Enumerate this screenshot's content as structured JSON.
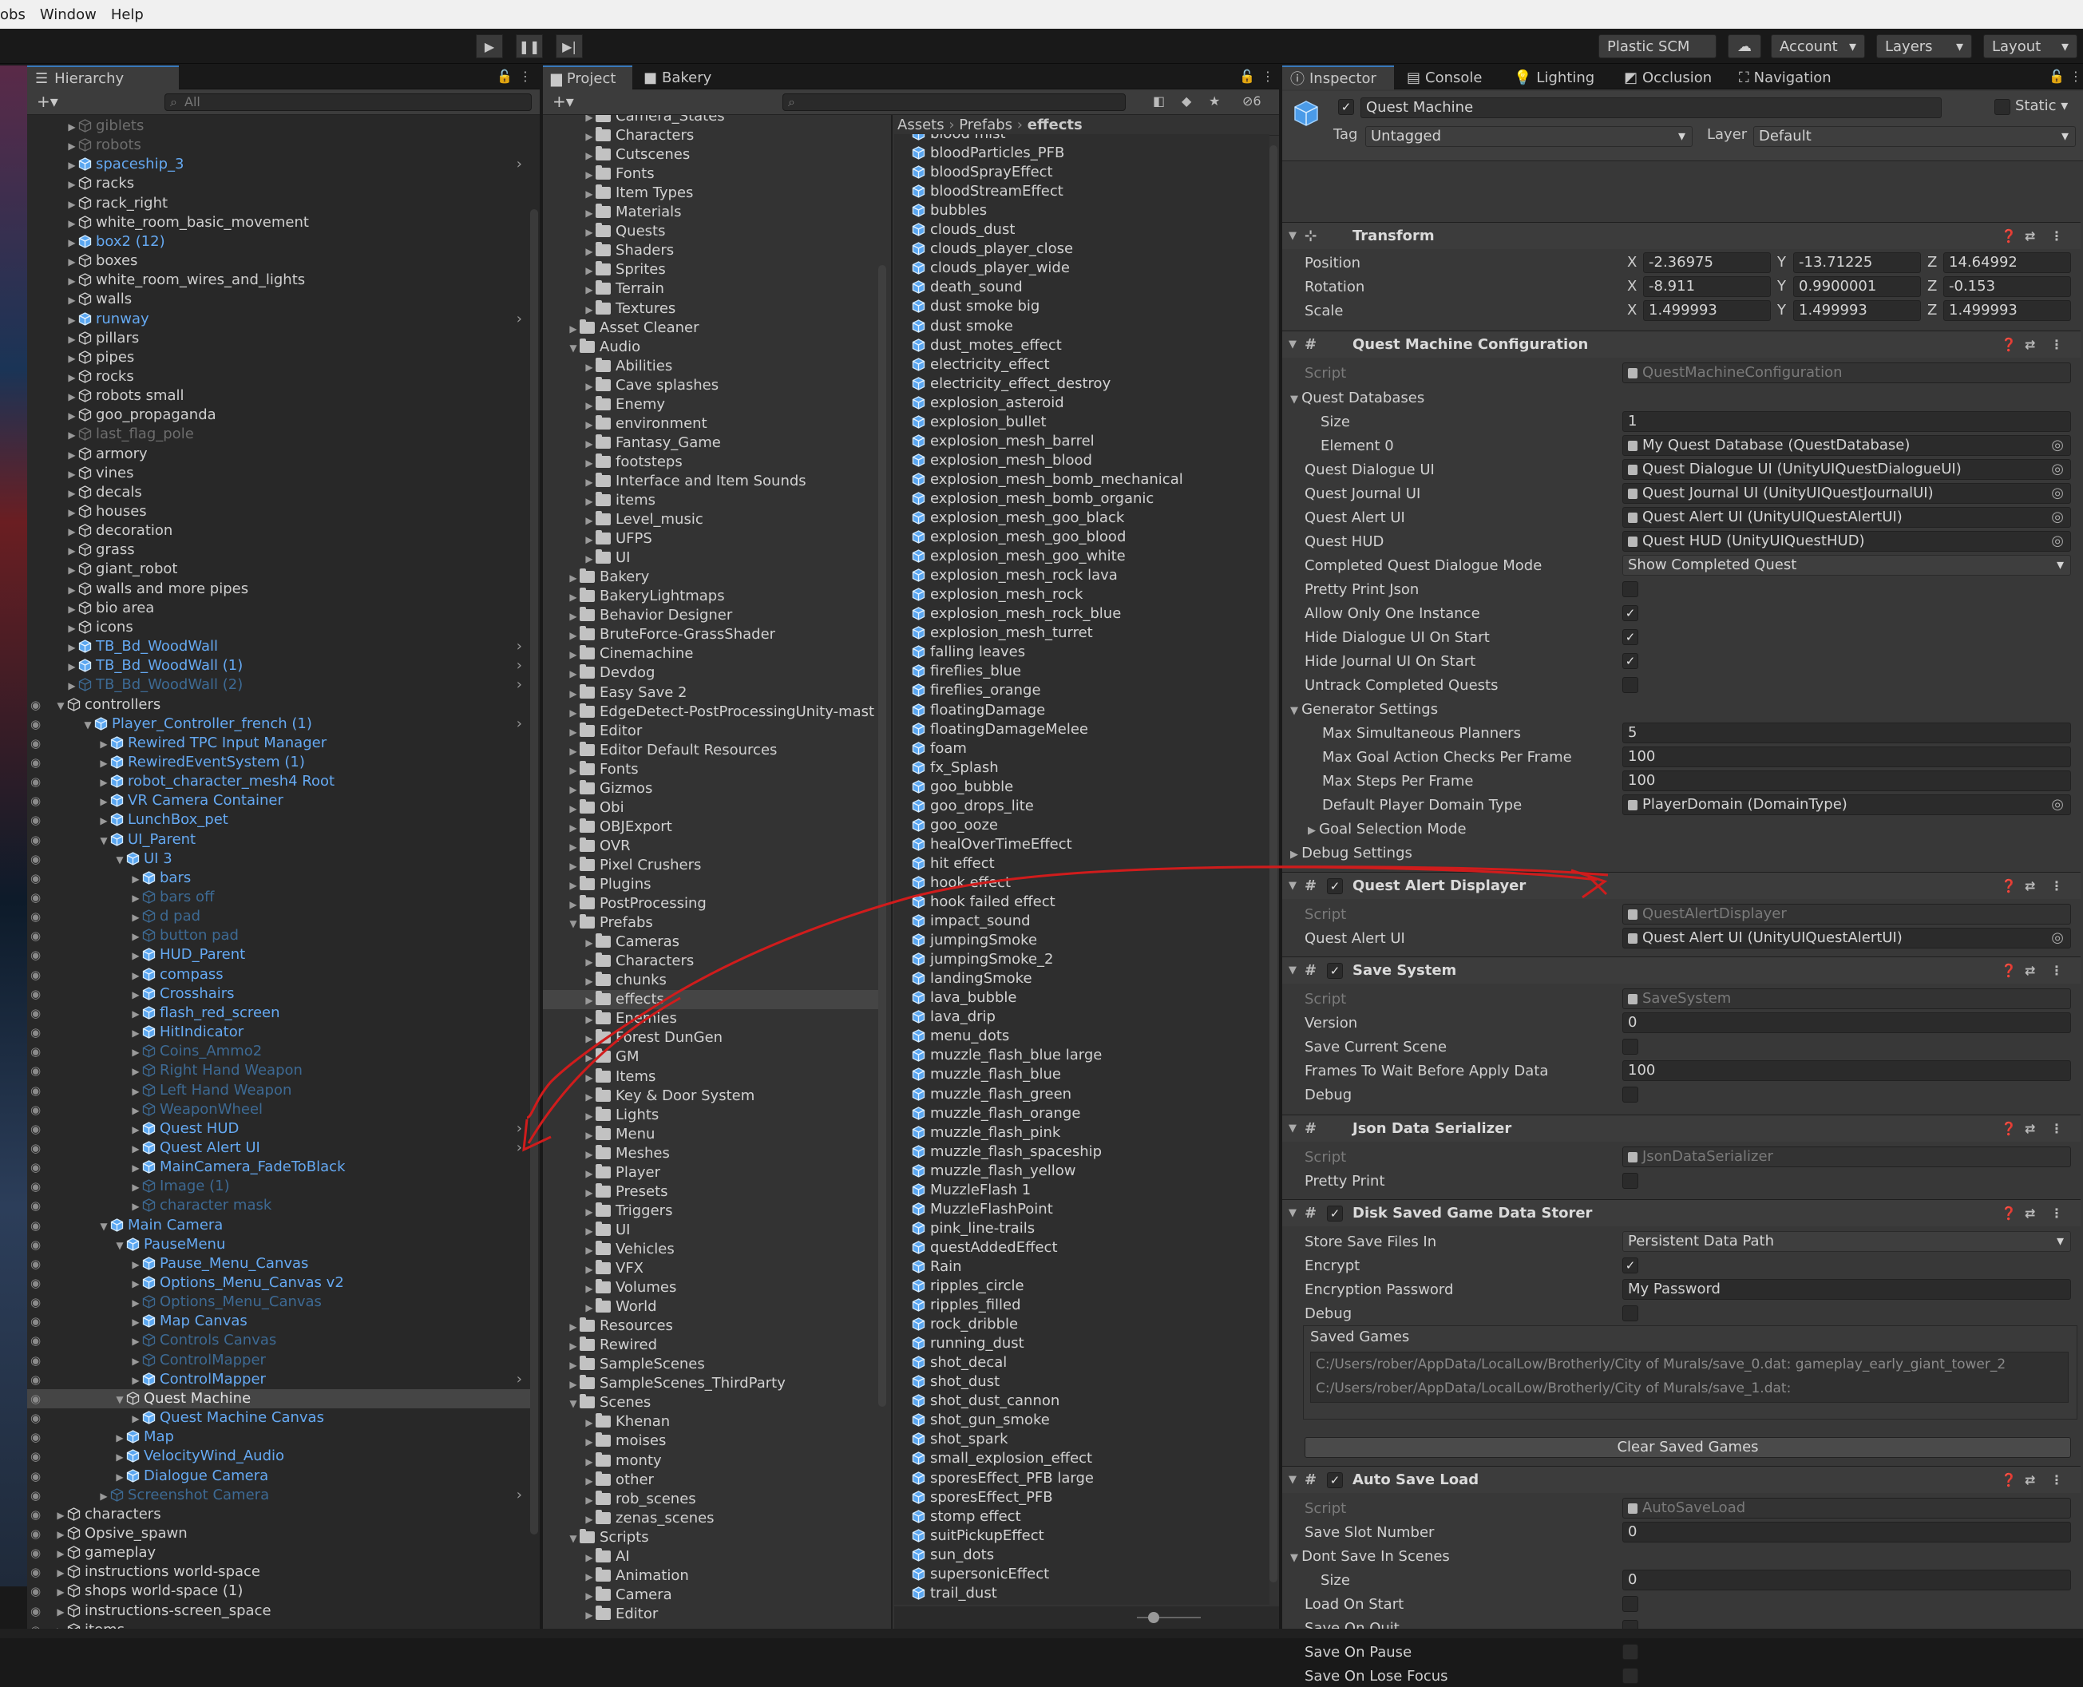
{
  "menu": [
    "obs",
    "Window",
    "Help"
  ],
  "toolbar": {
    "plastic": "Plastic SCM",
    "account": "Account",
    "layers": "Layers",
    "layout": "Layout"
  },
  "hierarchy": {
    "tab": "Hierarchy",
    "search_placeholder": "All",
    "rows": [
      {
        "t": "giblets",
        "i": 0,
        "s": "dim"
      },
      {
        "t": "robots",
        "i": 0,
        "s": "dim"
      },
      {
        "t": "spaceship_3",
        "i": 0,
        "s": "blue"
      },
      {
        "t": "racks",
        "i": 0,
        "s": ""
      },
      {
        "t": "rack_right",
        "i": 0,
        "s": ""
      },
      {
        "t": "white_room_basic_movement",
        "i": 0,
        "s": ""
      },
      {
        "t": "box2 (12)",
        "i": 0,
        "s": "blue"
      },
      {
        "t": "boxes",
        "i": 0,
        "s": ""
      },
      {
        "t": "white_room_wires_and_lights",
        "i": 0,
        "s": ""
      },
      {
        "t": "walls",
        "i": 0,
        "s": ""
      },
      {
        "t": "runway",
        "i": 0,
        "s": "blue"
      },
      {
        "t": "pillars",
        "i": 0,
        "s": ""
      },
      {
        "t": "pipes",
        "i": 0,
        "s": ""
      },
      {
        "t": "rocks",
        "i": 0,
        "s": ""
      },
      {
        "t": "robots small",
        "i": 0,
        "s": ""
      },
      {
        "t": "goo_propaganda",
        "i": 0,
        "s": ""
      },
      {
        "t": "last_flag_pole",
        "i": 0,
        "s": "dim"
      },
      {
        "t": "armory",
        "i": 0,
        "s": ""
      },
      {
        "t": "vines",
        "i": 0,
        "s": ""
      },
      {
        "t": "decals",
        "i": 0,
        "s": ""
      },
      {
        "t": "houses",
        "i": 0,
        "s": ""
      },
      {
        "t": "decoration",
        "i": 0,
        "s": ""
      },
      {
        "t": "grass",
        "i": 0,
        "s": ""
      },
      {
        "t": "giant_robot",
        "i": 0,
        "s": ""
      },
      {
        "t": "walls and more pipes",
        "i": 0,
        "s": ""
      },
      {
        "t": "bio area",
        "i": 0,
        "s": ""
      },
      {
        "t": "icons",
        "i": 0,
        "s": ""
      },
      {
        "t": "TB_Bd_WoodWall",
        "i": 0,
        "s": "blue"
      },
      {
        "t": "TB_Bd_WoodWall (1)",
        "i": 0,
        "s": "blue"
      },
      {
        "t": "TB_Bd_WoodWall (2)",
        "i": 0,
        "s": "dimblue"
      },
      {
        "t": "controllers",
        "i": -1,
        "s": ""
      },
      {
        "t": "Player_Controller_french (1)",
        "i": 0,
        "s": "blue"
      },
      {
        "t": "Rewired TPC Input Manager",
        "i": 1,
        "s": "blue"
      },
      {
        "t": "RewiredEventSystem (1)",
        "i": 1,
        "s": "blue"
      },
      {
        "t": "robot_character_mesh4 Root",
        "i": 1,
        "s": "blue"
      },
      {
        "t": "VR Camera Container",
        "i": 1,
        "s": "blue"
      },
      {
        "t": "LunchBox_pet",
        "i": 1,
        "s": "blue"
      },
      {
        "t": "UI_Parent",
        "i": 1,
        "s": "blue"
      },
      {
        "t": "UI 3",
        "i": 2,
        "s": "blue"
      },
      {
        "t": "bars",
        "i": 3,
        "s": "blue"
      },
      {
        "t": "bars off",
        "i": 3,
        "s": "dimblue"
      },
      {
        "t": "d pad",
        "i": 3,
        "s": "dimblue"
      },
      {
        "t": "button pad",
        "i": 3,
        "s": "dimblue"
      },
      {
        "t": "HUD_Parent",
        "i": 3,
        "s": "blue"
      },
      {
        "t": "compass",
        "i": 3,
        "s": "blue"
      },
      {
        "t": "Crosshairs",
        "i": 3,
        "s": "blue"
      },
      {
        "t": "flash_red_screen",
        "i": 3,
        "s": "blue"
      },
      {
        "t": "HitIndicator",
        "i": 3,
        "s": "blue"
      },
      {
        "t": "Coins_Ammo2",
        "i": 3,
        "s": "dimblue"
      },
      {
        "t": "Right Hand Weapon",
        "i": 3,
        "s": "dimblue"
      },
      {
        "t": "Left Hand Weapon",
        "i": 3,
        "s": "dimblue"
      },
      {
        "t": "WeaponWheel",
        "i": 3,
        "s": "dimblue"
      },
      {
        "t": "Quest HUD",
        "i": 3,
        "s": "blue"
      },
      {
        "t": "Quest Alert UI",
        "i": 3,
        "s": "blue"
      },
      {
        "t": "MainCamera_FadeToBlack",
        "i": 3,
        "s": "blue"
      },
      {
        "t": "Image (1)",
        "i": 3,
        "s": "dimblue"
      },
      {
        "t": "character mask",
        "i": 3,
        "s": "dimblue"
      },
      {
        "t": "Main Camera",
        "i": 1,
        "s": "blue"
      },
      {
        "t": "PauseMenu",
        "i": 2,
        "s": "blue"
      },
      {
        "t": "Pause_Menu_Canvas",
        "i": 3,
        "s": "blue"
      },
      {
        "t": "Options_Menu_Canvas v2",
        "i": 3,
        "s": "blue"
      },
      {
        "t": "Options_Menu_Canvas",
        "i": 3,
        "s": "dimblue"
      },
      {
        "t": "Map Canvas",
        "i": 3,
        "s": "blue"
      },
      {
        "t": "Controls Canvas",
        "i": 3,
        "s": "dimblue"
      },
      {
        "t": "ControlMapper",
        "i": 3,
        "s": "dimblue"
      },
      {
        "t": "ControlMapper",
        "i": 3,
        "s": "blue"
      },
      {
        "t": "Quest Machine",
        "i": 2,
        "s": "sel"
      },
      {
        "t": "Quest Machine Canvas",
        "i": 3,
        "s": "blue"
      },
      {
        "t": "Map",
        "i": 2,
        "s": "blue"
      },
      {
        "t": "VelocityWind_Audio",
        "i": 2,
        "s": "blue"
      },
      {
        "t": "Dialogue Camera",
        "i": 2,
        "s": "blue"
      },
      {
        "t": "Screenshot Camera",
        "i": 1,
        "s": "dimblue"
      },
      {
        "t": "characters",
        "i": -1,
        "s": ""
      },
      {
        "t": "Opsive_spawn",
        "i": -1,
        "s": ""
      },
      {
        "t": "gameplay",
        "i": -1,
        "s": ""
      },
      {
        "t": "instructions world-space",
        "i": -1,
        "s": ""
      },
      {
        "t": "shops world-space (1)",
        "i": -1,
        "s": ""
      },
      {
        "t": "instructions-screen_space",
        "i": -1,
        "s": ""
      },
      {
        "t": "items",
        "i": -1,
        "s": ""
      }
    ]
  },
  "project": {
    "tabs": [
      "Project",
      "Bakery"
    ],
    "breadcrumb": [
      "Assets",
      "Prefabs",
      "effects"
    ],
    "badge": "6",
    "folders": [
      {
        "t": "Camera_States",
        "i": 2
      },
      {
        "t": "Characters",
        "i": 2
      },
      {
        "t": "Cutscenes",
        "i": 2
      },
      {
        "t": "Fonts",
        "i": 2
      },
      {
        "t": "Item Types",
        "i": 2
      },
      {
        "t": "Materials",
        "i": 2
      },
      {
        "t": "Quests",
        "i": 2
      },
      {
        "t": "Shaders",
        "i": 2
      },
      {
        "t": "Sprites",
        "i": 2
      },
      {
        "t": "Terrain",
        "i": 2
      },
      {
        "t": "Textures",
        "i": 2
      },
      {
        "t": "Asset Cleaner",
        "i": 1
      },
      {
        "t": "Audio",
        "i": 1
      },
      {
        "t": "Abilities",
        "i": 2
      },
      {
        "t": "Cave splashes",
        "i": 2
      },
      {
        "t": "Enemy",
        "i": 2
      },
      {
        "t": "environment",
        "i": 2
      },
      {
        "t": "Fantasy_Game",
        "i": 2
      },
      {
        "t": "footsteps",
        "i": 2
      },
      {
        "t": "Interface and Item Sounds",
        "i": 2
      },
      {
        "t": "items",
        "i": 2
      },
      {
        "t": "Level_music",
        "i": 2
      },
      {
        "t": "UFPS",
        "i": 2
      },
      {
        "t": "UI",
        "i": 2
      },
      {
        "t": "Bakery",
        "i": 1
      },
      {
        "t": "BakeryLightmaps",
        "i": 1
      },
      {
        "t": "Behavior Designer",
        "i": 1
      },
      {
        "t": "BruteForce-GrassShader",
        "i": 1
      },
      {
        "t": "Cinemachine",
        "i": 1
      },
      {
        "t": "Devdog",
        "i": 1
      },
      {
        "t": "Easy Save 2",
        "i": 1
      },
      {
        "t": "EdgeDetect-PostProcessingUnity-mast",
        "i": 1
      },
      {
        "t": "Editor",
        "i": 1
      },
      {
        "t": "Editor Default Resources",
        "i": 1
      },
      {
        "t": "Fonts",
        "i": 1
      },
      {
        "t": "Gizmos",
        "i": 1
      },
      {
        "t": "Obi",
        "i": 1
      },
      {
        "t": "OBJExport",
        "i": 1
      },
      {
        "t": "OVR",
        "i": 1
      },
      {
        "t": "Pixel Crushers",
        "i": 1
      },
      {
        "t": "Plugins",
        "i": 1
      },
      {
        "t": "PostProcessing",
        "i": 1
      },
      {
        "t": "Prefabs",
        "i": 1
      },
      {
        "t": "Cameras",
        "i": 2
      },
      {
        "t": "Characters",
        "i": 2
      },
      {
        "t": "chunks",
        "i": 2
      },
      {
        "t": "effects",
        "i": 2
      },
      {
        "t": "Enemies",
        "i": 2
      },
      {
        "t": "Forest DunGen",
        "i": 2
      },
      {
        "t": "GM",
        "i": 2
      },
      {
        "t": "Items",
        "i": 2
      },
      {
        "t": "Key & Door System",
        "i": 2
      },
      {
        "t": "Lights",
        "i": 2
      },
      {
        "t": "Menu",
        "i": 2
      },
      {
        "t": "Meshes",
        "i": 2
      },
      {
        "t": "Player",
        "i": 2
      },
      {
        "t": "Presets",
        "i": 2
      },
      {
        "t": "Triggers",
        "i": 2
      },
      {
        "t": "UI",
        "i": 2
      },
      {
        "t": "Vehicles",
        "i": 2
      },
      {
        "t": "VFX",
        "i": 2
      },
      {
        "t": "Volumes",
        "i": 2
      },
      {
        "t": "World",
        "i": 2
      },
      {
        "t": "Resources",
        "i": 1
      },
      {
        "t": "Rewired",
        "i": 1
      },
      {
        "t": "SampleScenes",
        "i": 1
      },
      {
        "t": "SampleScenes_ThirdParty",
        "i": 1
      },
      {
        "t": "Scenes",
        "i": 1
      },
      {
        "t": "Khenan",
        "i": 2
      },
      {
        "t": "moises",
        "i": 2
      },
      {
        "t": "monty",
        "i": 2
      },
      {
        "t": "other",
        "i": 2
      },
      {
        "t": "rob_scenes",
        "i": 2
      },
      {
        "t": "zenas_scenes",
        "i": 2
      },
      {
        "t": "Scripts",
        "i": 1
      },
      {
        "t": "AI",
        "i": 2
      },
      {
        "t": "Animation",
        "i": 2
      },
      {
        "t": "Camera",
        "i": 2
      },
      {
        "t": "Editor",
        "i": 2
      }
    ],
    "assets": [
      "blood mist",
      "bloodParticles_PFB",
      "bloodSprayEffect",
      "bloodStreamEffect",
      "bubbles",
      "clouds_dust",
      "clouds_player_close",
      "clouds_player_wide",
      "death_sound",
      "dust smoke big",
      "dust smoke",
      "dust_motes_effect",
      "electricity_effect",
      "electricity_effect_destroy",
      "explosion_asteroid",
      "explosion_bullet",
      "explosion_mesh_barrel",
      "explosion_mesh_blood",
      "explosion_mesh_bomb_mechanical",
      "explosion_mesh_bomb_organic",
      "explosion_mesh_goo_black",
      "explosion_mesh_goo_blood",
      "explosion_mesh_goo_white",
      "explosion_mesh_rock lava",
      "explosion_mesh_rock",
      "explosion_mesh_rock_blue",
      "explosion_mesh_turret",
      "falling leaves",
      "fireflies_blue",
      "fireflies_orange",
      "floatingDamage",
      "floatingDamageMelee",
      "foam",
      "fx_Splash",
      "goo_bubble",
      "goo_drops_lite",
      "goo_ooze",
      "healOverTimeEffect",
      "hit effect",
      "hook effect",
      "hook failed effect",
      "impact_sound",
      "jumpingSmoke",
      "jumpingSmoke_2",
      "landingSmoke",
      "lava_bubble",
      "lava_drip",
      "menu_dots",
      "muzzle_flash_blue large",
      "muzzle_flash_blue",
      "muzzle_flash_green",
      "muzzle_flash_orange",
      "muzzle_flash_pink",
      "muzzle_flash_spaceship",
      "muzzle_flash_yellow",
      "MuzzleFlash 1",
      "MuzzleFlashPoint",
      "pink_line-trails",
      "questAddedEffect",
      "Rain",
      "ripples_circle",
      "ripples_filled",
      "rock_dribble",
      "running_dust",
      "shot_decal",
      "shot_dust",
      "shot_dust_cannon",
      "shot_gun_smoke",
      "shot_spark",
      "small_explosion_effect",
      "sporesEffect_PFB large",
      "sporesEffect_PFB",
      "stomp effect",
      "suitPickupEffect",
      "sun_dots",
      "supersonicEffect",
      "trail_dust"
    ]
  },
  "inspector": {
    "tabs": [
      "Inspector",
      "Console",
      "Lighting",
      "Occlusion",
      "Navigation"
    ],
    "object_name": "Quest Machine",
    "static_label": "Static",
    "tag_label": "Tag",
    "tag": "Untagged",
    "layer_label": "Layer",
    "layer": "Default",
    "transform": {
      "title": "Transform",
      "rows": [
        {
          "label": "Position",
          "x": "-2.36975",
          "y": "-13.71225",
          "z": "14.64992"
        },
        {
          "label": "Rotation",
          "x": "-8.911",
          "y": "0.9900001",
          "z": "-0.153"
        },
        {
          "label": "Scale",
          "x": "1.499993",
          "y": "1.499993",
          "z": "1.499993"
        }
      ]
    },
    "axis": [
      "X",
      "Y",
      "Z"
    ],
    "qmc": {
      "title": "Quest Machine Configuration",
      "script": "QuestMachineConfiguration",
      "quest_db": "Quest Databases",
      "size_label": "Size",
      "size": "1",
      "el0_label": "Element 0",
      "el0": "My Quest Database (QuestDatabase)",
      "dlg_label": "Quest Dialogue UI",
      "dlg": "Quest Dialogue UI (UnityUIQuestDialogueUI)",
      "jrn_label": "Quest Journal UI",
      "jrn": "Quest Journal UI (UnityUIQuestJournalUI)",
      "alr_label": "Quest Alert UI",
      "alr": "Quest Alert UI (UnityUIQuestAlertUI)",
      "hud_label": "Quest HUD",
      "hud": "Quest HUD (UnityUIQuestHUD)",
      "cqdm_label": "Completed Quest Dialogue Mode",
      "cqdm": "Show Completed Quest",
      "ppj": "Pretty Print Json",
      "aooi": "Allow Only One Instance",
      "hdus": "Hide Dialogue UI On Start",
      "hjus": "Hide Journal UI On Start",
      "ucq": "Untrack Completed Quests",
      "gen": "Generator Settings",
      "msp_label": "Max Simultaneous Planners",
      "msp": "5",
      "mgac_label": "Max Goal Action Checks Per Frame",
      "mgac": "100",
      "mspf_label": "Max Steps Per Frame",
      "mspf": "100",
      "dpdt_label": "Default Player Domain Type",
      "dpdt": "PlayerDomain (DomainType)",
      "gsm": "Goal Selection Mode",
      "dbg": "Debug Settings"
    },
    "qad": {
      "title": "Quest Alert Displayer",
      "script": "QuestAlertDisplayer",
      "alr_label": "Quest Alert UI",
      "alr": "Quest Alert UI (UnityUIQuestAlertUI)"
    },
    "ss": {
      "title": "Save System",
      "script": "SaveSystem",
      "ver_label": "Version",
      "ver": "0",
      "scs": "Save Current Scene",
      "ftw_label": "Frames To Wait Before Apply Data",
      "ftw": "100",
      "debug": "Debug"
    },
    "jds": {
      "title": "Json Data Serializer",
      "script": "JsonDataSerializer",
      "pp": "Pretty Print"
    },
    "dsg": {
      "title": "Disk Saved Game Data Storer",
      "ssfi_label": "Store Save Files In",
      "ssfi": "Persistent Data Path",
      "enc": "Encrypt",
      "encp_label": "Encryption Password",
      "encp": "My Password",
      "debug": "Debug",
      "saved": "Saved Games",
      "save0": "C:/Users/rober/AppData/LocalLow/Brotherly/City of Murals/save_0.dat: gameplay_early_giant_tower_2",
      "save1": "C:/Users/rober/AppData/LocalLow/Brotherly/City of Murals/save_1.dat:",
      "clear": "Clear Saved Games"
    },
    "asl": {
      "title": "Auto Save Load",
      "script": "AutoSaveLoad",
      "ssn_label": "Save Slot Number",
      "ssn": "0",
      "dsis": "Dont Save In Scenes",
      "size_label": "Size",
      "size": "0",
      "los": "Load On Start",
      "soq": "Save On Quit",
      "sop": "Save On Pause",
      "solf": "Save On Lose Focus"
    },
    "script_label": "Script"
  },
  "colors": {
    "accent": "#3a79bb",
    "prefab": "#65a9f2",
    "annotation": "#d01c1c"
  }
}
